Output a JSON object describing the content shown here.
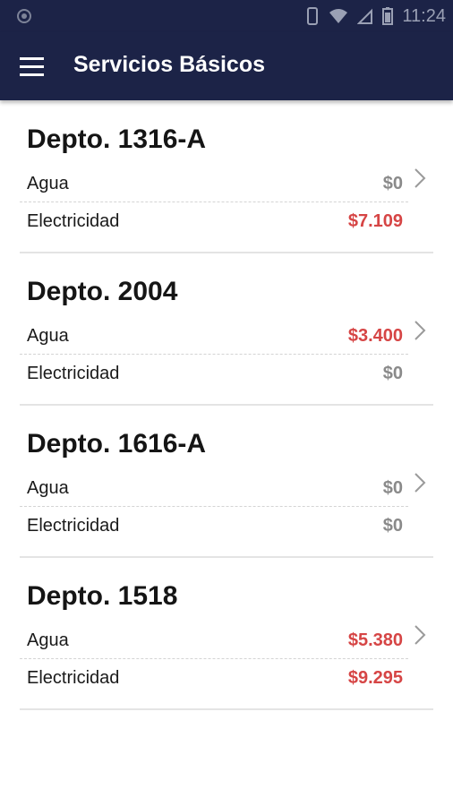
{
  "status_bar": {
    "time": "11:24",
    "icons": [
      "android-debug-icon",
      "vibrate-icon",
      "wifi-icon",
      "signal-icon",
      "battery-icon"
    ]
  },
  "app_bar": {
    "title": "Servicios Básicos",
    "menu_icon": "hamburger-menu-icon"
  },
  "colors": {
    "primary": "#1c2347",
    "due": "#d64545",
    "zero": "#8a8a8a"
  },
  "apartments": [
    {
      "name": "Depto. 1316-A",
      "water_label": "Agua",
      "water_value": "$0",
      "water_due": false,
      "elec_label": "Electricidad",
      "elec_value": "$7.109",
      "elec_due": true
    },
    {
      "name": "Depto. 2004",
      "water_label": "Agua",
      "water_value": "$3.400",
      "water_due": true,
      "elec_label": "Electricidad",
      "elec_value": "$0",
      "elec_due": false
    },
    {
      "name": "Depto. 1616-A",
      "water_label": "Agua",
      "water_value": "$0",
      "water_due": false,
      "elec_label": "Electricidad",
      "elec_value": "$0",
      "elec_due": false
    },
    {
      "name": "Depto. 1518",
      "water_label": "Agua",
      "water_value": "$5.380",
      "water_due": true,
      "elec_label": "Electricidad",
      "elec_value": "$9.295",
      "elec_due": true
    }
  ]
}
